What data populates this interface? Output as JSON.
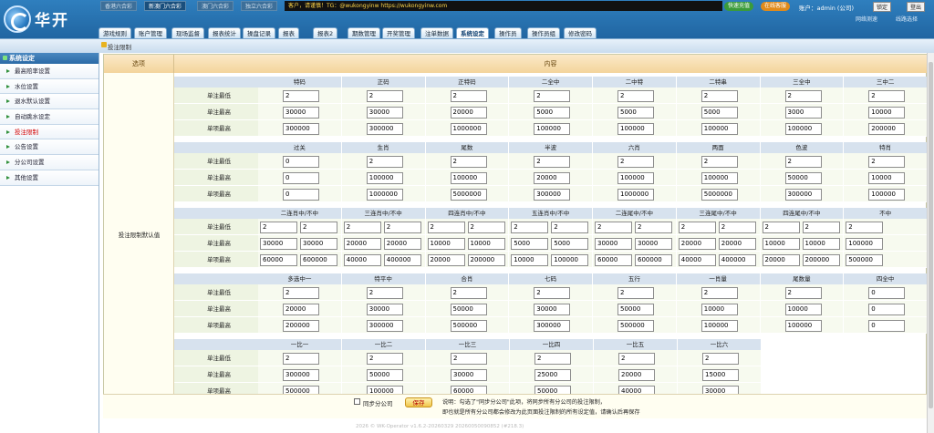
{
  "brand": "华开",
  "lotteries": [
    "香港六合彩",
    "新澳门六合彩",
    "澳门六合彩",
    "独立六合彩"
  ],
  "notice": "客户，请谨慎！TG：@wukongyinw  https://wukongyinw.com",
  "pills": {
    "fast": "快速充值",
    "online": "在线客服"
  },
  "account": "账户：admin (公司)",
  "top_buttons": {
    "lock": "锁定",
    "logout": "登出",
    "line_test": "网络测速",
    "line_select": "线路选择"
  },
  "tabs": [
    "游戏规则",
    "账户管理",
    "现场监督",
    "报表统计",
    "操盘记录",
    "报表",
    "报表2",
    "期数管理",
    "开奖管理",
    "注单数据",
    "系统设定",
    "操作员",
    "操作员组",
    "修改密码"
  ],
  "breadcrumb": "投注限制",
  "sidebar": {
    "title": "系统设定",
    "items": [
      "最高赔率设置",
      "水位设置",
      "退水默认设置",
      "自动跳水设定",
      "投注限制",
      "公告设置",
      "分公司设置",
      "其他设置"
    ]
  },
  "table": {
    "col_option": "选项",
    "col_content": "内容",
    "left_label": "投注限制默认值",
    "row_labels": [
      "单注最低",
      "单注最高",
      "单项最高"
    ],
    "sections": [
      {
        "cols": [
          "特码",
          "正码",
          "正特码",
          "二全中",
          "二中特",
          "二特串",
          "三全中",
          "三中二"
        ],
        "rows": [
          [
            "2",
            "2",
            "2",
            "2",
            "2",
            "2",
            "2",
            "2"
          ],
          [
            "30000",
            "30000",
            "20000",
            "5000",
            "5000",
            "5000",
            "3000",
            "10000"
          ],
          [
            "300000",
            "300000",
            "1000000",
            "100000",
            "100000",
            "100000",
            "100000",
            "200000"
          ]
        ]
      },
      {
        "cols": [
          "过关",
          "生肖",
          "尾数",
          "半波",
          "六肖",
          "两面",
          "色波",
          "特肖"
        ],
        "rows": [
          [
            "0",
            "2",
            "2",
            "2",
            "2",
            "2",
            "2",
            "2"
          ],
          [
            "0",
            "100000",
            "100000",
            "20000",
            "100000",
            "100000",
            "50000",
            "10000"
          ],
          [
            "0",
            "1000000",
            "5000000",
            "300000",
            "1000000",
            "5000000",
            "300000",
            "100000"
          ]
        ]
      },
      {
        "cols": [
          "二连肖中/不中",
          "三连肖中/不中",
          "四连肖中/不中",
          "五连肖中/不中",
          "二连尾中/不中",
          "三连尾中/不中",
          "四连尾中/不中",
          "不中"
        ],
        "rows": [
          [
            [
              "2",
              "2"
            ],
            [
              "2",
              "2"
            ],
            [
              "2",
              "2"
            ],
            [
              "2",
              "2"
            ],
            [
              "2",
              "2"
            ],
            [
              "2",
              "2"
            ],
            [
              "2",
              "2"
            ],
            [
              "2"
            ]
          ],
          [
            [
              "30000",
              "30000"
            ],
            [
              "20000",
              "20000"
            ],
            [
              "10000",
              "10000"
            ],
            [
              "5000",
              "5000"
            ],
            [
              "30000",
              "30000"
            ],
            [
              "20000",
              "20000"
            ],
            [
              "10000",
              "10000"
            ],
            [
              "100000"
            ]
          ],
          [
            [
              "60000",
              "600000"
            ],
            [
              "40000",
              "400000"
            ],
            [
              "20000",
              "200000"
            ],
            [
              "10000",
              "100000"
            ],
            [
              "60000",
              "600000"
            ],
            [
              "40000",
              "400000"
            ],
            [
              "20000",
              "200000"
            ],
            [
              "500000"
            ]
          ]
        ]
      },
      {
        "cols": [
          "多选中一",
          "特平中",
          "合肖",
          "七码",
          "五行",
          "一肖量",
          "尾数量",
          "四全中"
        ],
        "rows": [
          [
            "2",
            "2",
            "2",
            "2",
            "2",
            "2",
            "2",
            "0"
          ],
          [
            "20000",
            "30000",
            "50000",
            "30000",
            "50000",
            "10000",
            "10000",
            "0"
          ],
          [
            "200000",
            "300000",
            "500000",
            "300000",
            "500000",
            "100000",
            "100000",
            "0"
          ]
        ]
      },
      {
        "cols": [
          "一比一",
          "一比二",
          "一比三",
          "一比四",
          "一比五",
          "一比六"
        ],
        "rows": [
          [
            "2",
            "2",
            "2",
            "2",
            "2",
            "2"
          ],
          [
            "300000",
            "50000",
            "30000",
            "25000",
            "20000",
            "15000"
          ],
          [
            "500000",
            "100000",
            "60000",
            "50000",
            "40000",
            "30000"
          ]
        ]
      }
    ]
  },
  "footer": {
    "sync_label": "同步分公司",
    "save": "保存",
    "note1": "说明：勾选了\"同步分公司\"此项，将同步所有分公司的投注限制，",
    "note2": "即也就是所有分公司都会修改为此页面投注限制的所有设定值，请确认后再保存"
  },
  "copyright": "2026 © WK-Operator v1.6.2-20260329 20260050090852 (#218.3)"
}
